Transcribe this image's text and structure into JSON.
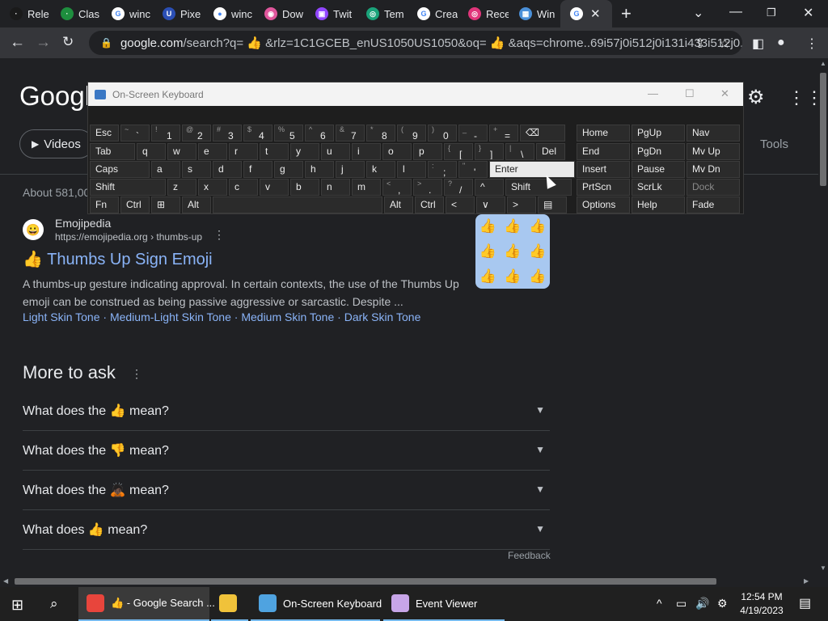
{
  "tabs": [
    {
      "label": "Rele",
      "color": "#1a1a1a",
      "glyph": "·"
    },
    {
      "label": "Clas",
      "color": "#1e8e3e",
      "glyph": "·"
    },
    {
      "label": "winc",
      "color": "#ffffff",
      "glyph": "G"
    },
    {
      "label": "Pixe",
      "color": "#2b4fb5",
      "glyph": "U"
    },
    {
      "label": "winc",
      "color": "#ffffff",
      "glyph": "●"
    },
    {
      "label": "Dow",
      "color": "#e0569c",
      "glyph": "◉"
    },
    {
      "label": "Twit",
      "color": "#9146ff",
      "glyph": "▣"
    },
    {
      "label": "Tem",
      "color": "#1aa37a",
      "glyph": "◎"
    },
    {
      "label": "Crea",
      "color": "#ffffff",
      "glyph": "G"
    },
    {
      "label": "Rece",
      "color": "#e0357a",
      "glyph": "◎"
    },
    {
      "label": "Win",
      "color": "#4a90d9",
      "glyph": "▦"
    },
    {
      "label": "",
      "color": "#ffffff",
      "glyph": "G",
      "active": true
    }
  ],
  "omnibox": {
    "host": "google.com",
    "path": "/search?q= 👍 &rlz=1C1GCEB_enUS1050US1050&oq= 👍 &aqs=chrome..69i57j0i512j0i131i433i512j0..."
  },
  "google_logo": "Google",
  "videos_chip": "Videos",
  "tools": "Tools",
  "about": "About 581,00",
  "result": {
    "site": "Emojipedia",
    "cite": "https://emojipedia.org › thumbs-up",
    "title": "👍 Thumbs Up Sign Emoji",
    "snippet": "A thumbs-up gesture indicating approval. In certain contexts, the use of the Thumbs Up emoji can be construed as being passive aggressive or sarcastic. Despite ...",
    "links": [
      "Light Skin Tone",
      "Medium-Light Skin Tone",
      "Medium Skin Tone",
      "Dark Skin Tone"
    ]
  },
  "more_to_ask": "More to ask",
  "questions": [
    "What does the 👍 mean?",
    "What does the 👎 mean?",
    "What does the 🙇🏿 mean?",
    "What does 👍 mean?"
  ],
  "feedback": "Feedback",
  "osk": {
    "title": "On-Screen Keyboard",
    "rows": [
      [
        {
          "k": "Esc"
        },
        {
          "s": "~",
          "k": "`"
        },
        {
          "s": "!",
          "k": "1"
        },
        {
          "s": "@",
          "k": "2"
        },
        {
          "s": "#",
          "k": "3"
        },
        {
          "s": "$",
          "k": "4"
        },
        {
          "s": "%",
          "k": "5"
        },
        {
          "s": "^",
          "k": "6"
        },
        {
          "s": "&",
          "k": "7"
        },
        {
          "s": "*",
          "k": "8"
        },
        {
          "s": "(",
          "k": "9"
        },
        {
          "s": ")",
          "k": "0"
        },
        {
          "s": "_",
          "k": "-"
        },
        {
          "s": "+",
          "k": "="
        },
        {
          "k": "⌫"
        }
      ],
      [
        {
          "k": "Tab"
        },
        {
          "k": "q"
        },
        {
          "k": "w"
        },
        {
          "k": "e"
        },
        {
          "k": "r"
        },
        {
          "k": "t"
        },
        {
          "k": "y"
        },
        {
          "k": "u"
        },
        {
          "k": "i"
        },
        {
          "k": "o"
        },
        {
          "k": "p"
        },
        {
          "s": "{",
          "k": "["
        },
        {
          "s": "}",
          "k": "]"
        },
        {
          "s": "|",
          "k": "\\"
        },
        {
          "k": "Del"
        }
      ],
      [
        {
          "k": "Caps"
        },
        {
          "k": "a"
        },
        {
          "k": "s"
        },
        {
          "k": "d"
        },
        {
          "k": "f"
        },
        {
          "k": "g"
        },
        {
          "k": "h"
        },
        {
          "k": "j"
        },
        {
          "k": "k"
        },
        {
          "k": "l"
        },
        {
          "s": ":",
          "k": ";"
        },
        {
          "s": "\"",
          "k": "'"
        },
        {
          "k": "Enter"
        }
      ],
      [
        {
          "k": "Shift"
        },
        {
          "k": "z"
        },
        {
          "k": "x"
        },
        {
          "k": "c"
        },
        {
          "k": "v"
        },
        {
          "k": "b"
        },
        {
          "k": "n"
        },
        {
          "k": "m"
        },
        {
          "s": "<",
          "k": ","
        },
        {
          "s": ">",
          "k": "."
        },
        {
          "s": "?",
          "k": "/"
        },
        {
          "k": "^"
        },
        {
          "k": "Shift"
        }
      ],
      [
        {
          "k": "Fn"
        },
        {
          "k": "Ctrl"
        },
        {
          "k": "⊞"
        },
        {
          "k": "Alt"
        },
        {
          "k": ""
        },
        {
          "k": "Alt"
        },
        {
          "k": "Ctrl"
        },
        {
          "k": "<"
        },
        {
          "k": "∨"
        },
        {
          "k": ">"
        },
        {
          "k": "▤"
        }
      ]
    ],
    "right": [
      [
        "Home",
        "PgUp",
        "Nav"
      ],
      [
        "End",
        "PgDn",
        "Mv Up"
      ],
      [
        "Insert",
        "Pause",
        "Mv Dn"
      ],
      [
        "PrtScn",
        "ScrLk",
        "Dock"
      ],
      [
        "Options",
        "Help",
        "Fade"
      ]
    ]
  },
  "taskbar": {
    "apps": [
      {
        "label": "👍 - Google Search ...",
        "color": "#e8453c"
      },
      {
        "label": "",
        "color": "#f0c23a"
      },
      {
        "label": "On-Screen Keyboard",
        "color": "#4fa3e0"
      },
      {
        "label": "Event Viewer",
        "color": "#c7a5e8"
      }
    ],
    "time": "12:54 PM",
    "date": "4/19/2023"
  }
}
